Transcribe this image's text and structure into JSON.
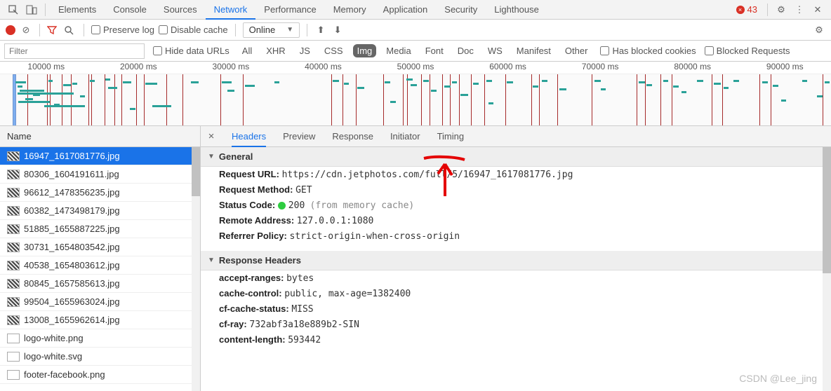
{
  "topTabs": [
    "Elements",
    "Console",
    "Sources",
    "Network",
    "Performance",
    "Memory",
    "Application",
    "Security",
    "Lighthouse"
  ],
  "topActive": 3,
  "errorCount": "43",
  "toolbar": {
    "preserveLog": "Preserve log",
    "disableCache": "Disable cache",
    "throttle": "Online"
  },
  "filterbar": {
    "placeholder": "Filter",
    "hideDataUrls": "Hide data URLs",
    "types": [
      "All",
      "XHR",
      "JS",
      "CSS",
      "Img",
      "Media",
      "Font",
      "Doc",
      "WS",
      "Manifest",
      "Other"
    ],
    "typeActive": 4,
    "hasBlocked": "Has blocked cookies",
    "blockedReq": "Blocked Requests"
  },
  "overview": {
    "ticks": [
      "10000 ms",
      "20000 ms",
      "30000 ms",
      "40000 ms",
      "50000 ms",
      "60000 ms",
      "70000 ms",
      "80000 ms",
      "90000 ms"
    ],
    "reloadLines": [
      3.3,
      5.7,
      6.0,
      7.4,
      8.5,
      10.6,
      11.0,
      12.6,
      13.8,
      14.6,
      16.4,
      17.3,
      20.0,
      22.0,
      26.5,
      29.2,
      39.9,
      41.2,
      42.8,
      46.1,
      48.5,
      49.0,
      50.7,
      51.7,
      53.2,
      54.1,
      55.2,
      56.7,
      58.3,
      60.8,
      63.9,
      64.9,
      67.1,
      71.2,
      76.6,
      77.6,
      79.5,
      80.8,
      85.6,
      86.9,
      91.4,
      92.7,
      99.0
    ],
    "segs": [
      [
        1.9,
        1.2,
        10
      ],
      [
        2.1,
        0.6,
        16
      ],
      [
        2.4,
        2.9,
        22
      ],
      [
        2.1,
        6.8,
        26
      ],
      [
        4.0,
        0.8,
        28
      ],
      [
        3.0,
        1.0,
        34
      ],
      [
        2.2,
        3.8,
        38
      ],
      [
        6.5,
        0.7,
        42
      ],
      [
        5.3,
        4.9,
        44
      ],
      [
        5.8,
        0.5,
        8
      ],
      [
        7.6,
        0.9,
        14
      ],
      [
        8.7,
        0.6,
        12
      ],
      [
        9.6,
        0.6,
        30
      ],
      [
        10.8,
        0.6,
        8
      ],
      [
        12.7,
        0.6,
        6
      ],
      [
        13.0,
        1.1,
        18
      ],
      [
        14.8,
        1.0,
        10
      ],
      [
        15.6,
        0.7,
        48
      ],
      [
        17.5,
        1.4,
        12
      ],
      [
        18.3,
        2.3,
        44
      ],
      [
        23.0,
        0.9,
        10
      ],
      [
        26.7,
        1.2,
        10
      ],
      [
        27.4,
        0.8,
        22
      ],
      [
        29.5,
        1.2,
        15
      ],
      [
        33.0,
        0.6,
        10
      ],
      [
        40.0,
        0.8,
        8
      ],
      [
        41.4,
        0.6,
        12
      ],
      [
        43.0,
        0.8,
        18
      ],
      [
        46.3,
        0.7,
        10
      ],
      [
        47.0,
        0.6,
        38
      ],
      [
        48.9,
        0.8,
        6
      ],
      [
        49.4,
        0.8,
        14
      ],
      [
        50.9,
        0.7,
        8
      ],
      [
        51.9,
        0.6,
        22
      ],
      [
        53.5,
        0.7,
        16
      ],
      [
        54.4,
        0.6,
        10
      ],
      [
        55.4,
        0.9,
        28
      ],
      [
        56.9,
        0.7,
        12
      ],
      [
        58.5,
        0.7,
        8
      ],
      [
        58.8,
        0.6,
        40
      ],
      [
        61.0,
        0.7,
        10
      ],
      [
        64.1,
        0.7,
        16
      ],
      [
        65.2,
        0.7,
        8
      ],
      [
        67.3,
        0.9,
        20
      ],
      [
        71.5,
        0.8,
        8
      ],
      [
        72.3,
        0.6,
        20
      ],
      [
        76.9,
        0.7,
        10
      ],
      [
        77.8,
        0.7,
        14
      ],
      [
        79.8,
        0.6,
        8
      ],
      [
        81.0,
        0.7,
        16
      ],
      [
        82.0,
        0.6,
        24
      ],
      [
        83.9,
        0.7,
        8
      ],
      [
        85.9,
        0.8,
        12
      ],
      [
        87.1,
        0.6,
        18
      ],
      [
        88.3,
        0.6,
        8
      ],
      [
        91.7,
        0.7,
        10
      ],
      [
        93.0,
        0.7,
        15
      ],
      [
        94.0,
        0.6,
        36
      ],
      [
        96.5,
        0.6,
        8
      ],
      [
        98.3,
        0.7,
        30
      ],
      [
        99.2,
        0.6,
        10
      ]
    ]
  },
  "left": {
    "header": "Name",
    "rows": [
      {
        "name": "16947_1617081776.jpg",
        "thumb": "img"
      },
      {
        "name": "80306_1604191611.jpg",
        "thumb": "img"
      },
      {
        "name": "96612_1478356235.jpg",
        "thumb": "img"
      },
      {
        "name": "60382_1473498179.jpg",
        "thumb": "img"
      },
      {
        "name": "51885_1655887225.jpg",
        "thumb": "img"
      },
      {
        "name": "30731_1654803542.jpg",
        "thumb": "img"
      },
      {
        "name": "40538_1654803612.jpg",
        "thumb": "img"
      },
      {
        "name": "80845_1657585613.jpg",
        "thumb": "img"
      },
      {
        "name": "99504_1655963024.jpg",
        "thumb": "img"
      },
      {
        "name": "13008_1655962614.jpg",
        "thumb": "img"
      },
      {
        "name": "logo-white.png",
        "thumb": "blank"
      },
      {
        "name": "logo-white.svg",
        "thumb": "blank"
      },
      {
        "name": "footer-facebook.png",
        "thumb": "blank"
      }
    ],
    "selected": 0
  },
  "detail": {
    "tabs": [
      "Headers",
      "Preview",
      "Response",
      "Initiator",
      "Timing"
    ],
    "active": 0,
    "general": {
      "title": "General",
      "url_lbl": "Request URL:",
      "url_val": "https://cdn.jetphotos.com/full/5/16947_1617081776.jpg",
      "method_lbl": "Request Method:",
      "method_val": "GET",
      "status_lbl": "Status Code:",
      "status_val": "200",
      "status_extra": "(from memory cache)",
      "remote_lbl": "Remote Address:",
      "remote_val": "127.0.0.1:1080",
      "ref_lbl": "Referrer Policy:",
      "ref_val": "strict-origin-when-cross-origin"
    },
    "respHeaders": {
      "title": "Response Headers",
      "items": [
        {
          "k": "accept-ranges:",
          "v": "bytes"
        },
        {
          "k": "cache-control:",
          "v": "public, max-age=1382400"
        },
        {
          "k": "cf-cache-status:",
          "v": "MISS"
        },
        {
          "k": "cf-ray:",
          "v": "732abf3a18e889b2-SIN"
        },
        {
          "k": "content-length:",
          "v": "593442"
        }
      ]
    }
  },
  "watermark": "CSDN @Lee_jing"
}
